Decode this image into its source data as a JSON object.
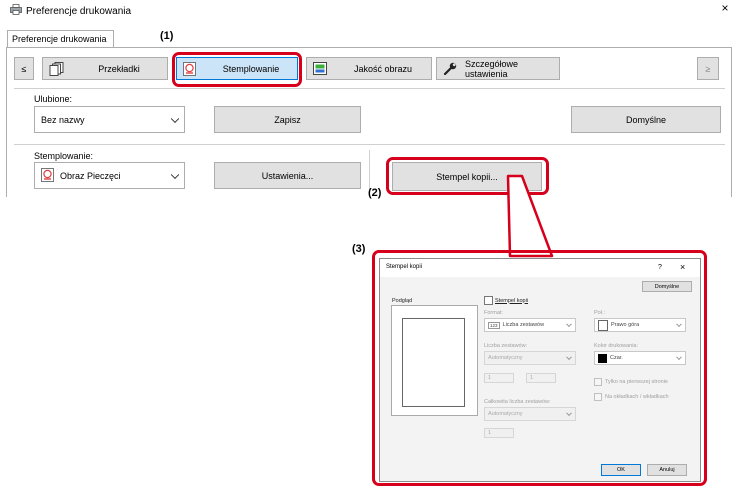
{
  "window": {
    "title": "Preferencje drukowania",
    "close_glyph": "×",
    "tab_label": "Preferencje drukowania"
  },
  "tabs_row": {
    "prev_label": "≤",
    "next_label": "≥",
    "items": [
      {
        "label": "Przekładki",
        "icon": "pages-icon"
      },
      {
        "label": "Stemplowanie",
        "icon": "stamp-icon"
      },
      {
        "label": "Jakość obrazu",
        "icon": "image-quality-icon"
      },
      {
        "label": "Szczegółowe ustawienia",
        "icon": "wrench-icon"
      }
    ]
  },
  "favorites": {
    "label": "Ulubione:",
    "value": "Bez nazwy",
    "save_label": "Zapisz",
    "defaults_label": "Domyślne"
  },
  "stamping": {
    "label": "Stemplowanie:",
    "value": "Obraz Pieczęci",
    "settings_label": "Ustawienia...",
    "copy_stamp_label": "Stempel kopii..."
  },
  "callouts": {
    "one": "(1)",
    "two": "(2)",
    "three": "(3)"
  },
  "dialog": {
    "title": "Stempel kopii",
    "help_glyph": "?",
    "close_glyph": "×",
    "defaults_label": "Domyślne",
    "preview_label": "Podgląd",
    "copy_stamp_checkbox": "Stempel kopii",
    "format_label": "Format:",
    "format_value": "Liczba zestawów",
    "format_icon_text": "123",
    "position_label": "Poł.:",
    "position_value": "Prawo góra",
    "sets_label": "Liczba zestawów:",
    "sets_value": "Automatyczny",
    "print_color_label": "Kolor drukowania:",
    "print_color_value": "Czar.",
    "field_a": "1",
    "field_b": "1",
    "first_page_only": "Tylko na pierwszej stronie",
    "covers_inserts": "Na okładkach / wkładkach",
    "total_sets_label": "Całkowita liczba zestawów:",
    "total_sets_value": "Automatyczny",
    "field_c": "1",
    "ok_label": "OK",
    "cancel_label": "Anuluj"
  },
  "colors": {
    "highlight_red": "#d6001c",
    "selected_tab_blue": "#cce4f7",
    "selected_tab_border": "#0078d7"
  }
}
